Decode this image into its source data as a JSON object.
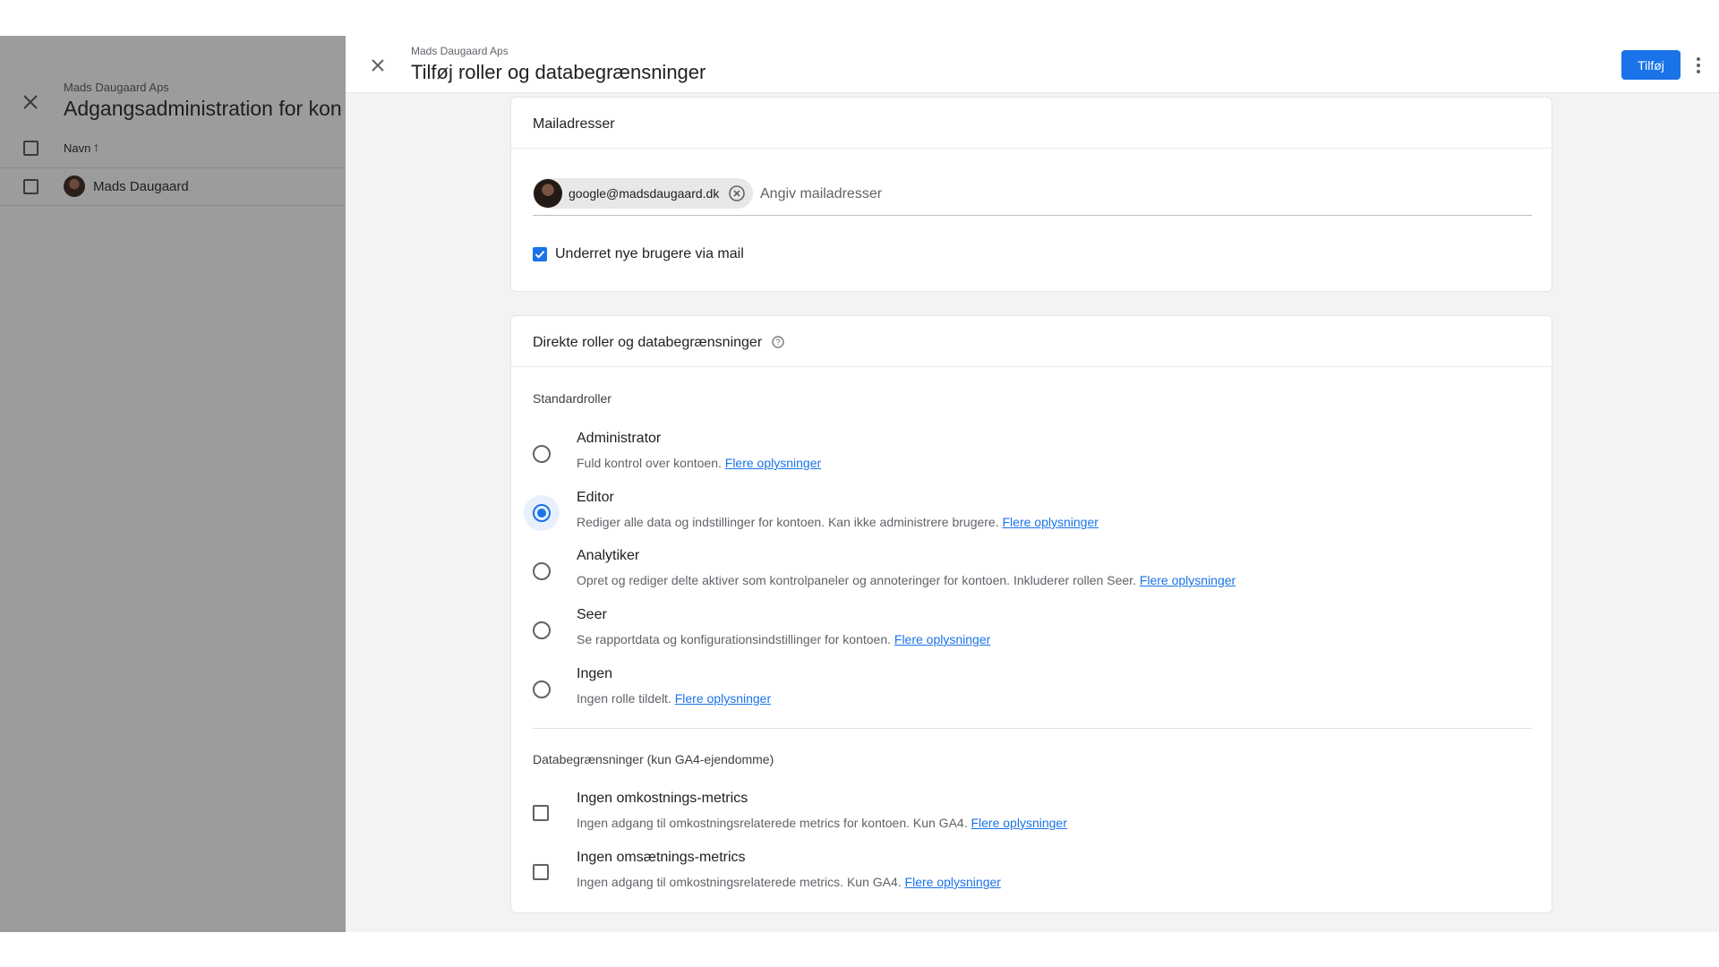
{
  "background_panel": {
    "subtitle": "Mads Daugaard Aps",
    "title": "Adgangsadministration for kon",
    "column_name": "Navn",
    "user_name": "Mads Daugaard"
  },
  "header": {
    "subtitle": "Mads Daugaard Aps",
    "title": "Tilføj roller og databegrænsninger",
    "add_button": "Tilføj"
  },
  "email_card": {
    "title": "Mailadresser",
    "chip_email": "google@madsdaugaard.dk",
    "input_placeholder": "Angiv mailadresser",
    "notify_label": "Underret nye brugere via mail",
    "notify_checked": true
  },
  "roles_card": {
    "title": "Direkte roller og databegrænsninger",
    "standard_roles_label": "Standardroller",
    "link_text": "Flere oplysninger",
    "selected_role": "Editor",
    "roles": [
      {
        "title": "Administrator",
        "desc": "Fuld kontrol over kontoen."
      },
      {
        "title": "Editor",
        "desc": "Rediger alle data og indstillinger for kontoen. Kan ikke administrere brugere."
      },
      {
        "title": "Analytiker",
        "desc": "Opret og rediger delte aktiver som kontrolpaneler og annoteringer for kontoen. Inkluderer rollen Seer."
      },
      {
        "title": "Seer",
        "desc": "Se rapportdata og konfigurationsindstillinger for kontoen."
      },
      {
        "title": "Ingen",
        "desc": "Ingen rolle tildelt."
      }
    ],
    "restrictions_label": "Databegrænsninger (kun GA4-ejendomme)",
    "restrictions": [
      {
        "title": "Ingen omkostnings-metrics",
        "desc": "Ingen adgang til omkostningsrelaterede metrics for kontoen. Kun GA4.",
        "checked": false
      },
      {
        "title": "Ingen omsætnings-metrics",
        "desc": "Ingen adgang til omkostningsrelaterede metrics. Kun GA4.",
        "checked": false
      }
    ]
  },
  "colors": {
    "accent": "#1a73e8",
    "overlay": "#9c9c9c",
    "sheet_background": "#f1f3f4"
  }
}
